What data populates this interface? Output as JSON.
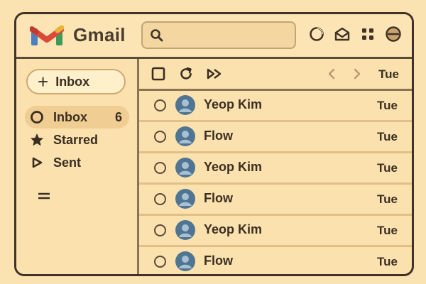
{
  "header": {
    "brand": "Gmail",
    "logo_icon": "gmail-m-logo-icon",
    "search_placeholder": "",
    "icons": [
      "status-circle-icon",
      "open-mail-icon",
      "apps-grid-icon",
      "account-avatar-icon"
    ]
  },
  "sidebar": {
    "compose_label": "Inbox",
    "items": [
      {
        "label": "Inbox",
        "icon": "circle-icon",
        "count": "6",
        "active": true
      },
      {
        "label": "Starred",
        "icon": "star-icon",
        "count": "",
        "active": false
      },
      {
        "label": "Sent",
        "icon": "send-icon",
        "count": "",
        "active": false
      }
    ],
    "more_icon": "more-lines-icon"
  },
  "toolbar": {
    "date": "Tue",
    "icons": [
      "select-checkbox-icon",
      "refresh-icon",
      "forward-all-icon",
      "chevron-left-icon",
      "chevron-right-icon"
    ]
  },
  "messages": [
    {
      "sender": "Yeop Kim",
      "time": "Tue"
    },
    {
      "sender": "Flow",
      "time": "Tue"
    },
    {
      "sender": "Yeop Kim",
      "time": "Tue"
    },
    {
      "sender": "Flow",
      "time": "Tue"
    },
    {
      "sender": "Yeop Kim",
      "time": "Tue"
    },
    {
      "sender": "Flow",
      "time": "Tue"
    }
  ],
  "colors": {
    "background": "#fbe3b1",
    "border": "#3f3226",
    "logo_red": "#d94a38",
    "logo_blue": "#4a7fc1",
    "logo_green": "#3f9a5a",
    "logo_yellow": "#e9b23a",
    "avatar": "#4f7593"
  }
}
